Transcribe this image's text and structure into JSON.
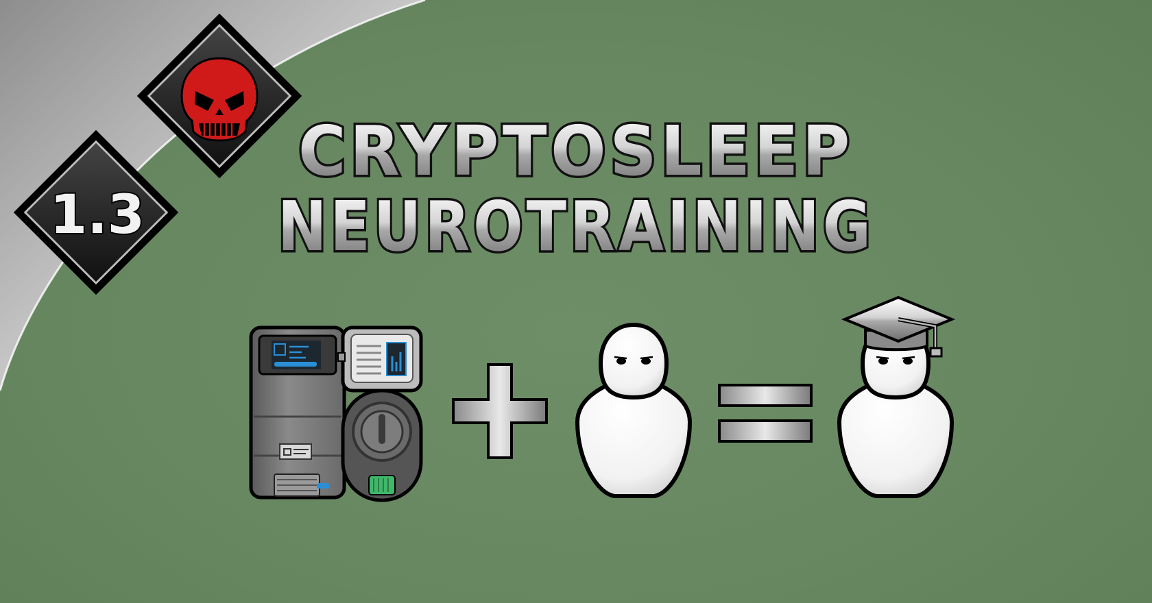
{
  "banner": {
    "version_label": "1.3",
    "title_line1": "CRYPTOSLEEP",
    "title_line2": "NEUROTRAINING"
  },
  "badges": [
    {
      "name": "version-badge",
      "icon": "version-number"
    },
    {
      "name": "skull-badge",
      "icon": "skull-icon"
    }
  ],
  "equation": {
    "items": [
      "cryptosleep-casket-icon",
      "plus-icon",
      "pawn-icon",
      "equals-icon",
      "graduated-pawn-icon"
    ]
  },
  "colors": {
    "background": "#678761",
    "skull": "#d01a1a",
    "badge_fill": "#1a1a1a",
    "text_metal_light": "#ffffff",
    "text_metal_dark": "#7a7a7a",
    "screen_accent": "#2a8fd6",
    "casket_accent": "#3fb86a"
  }
}
